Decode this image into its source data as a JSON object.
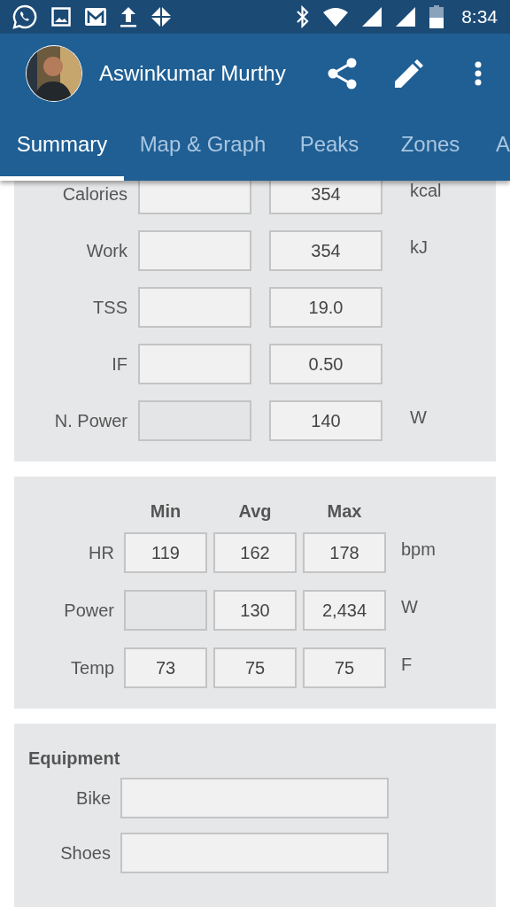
{
  "status_bar": {
    "time": "8:34"
  },
  "app_bar": {
    "title": "Aswinkumar Murthy"
  },
  "tabs": [
    {
      "label": "Summary",
      "selected": true
    },
    {
      "label": "Map & Graph",
      "selected": false
    },
    {
      "label": "Peaks",
      "selected": false
    },
    {
      "label": "Zones",
      "selected": false
    },
    {
      "label": "A",
      "selected": false
    }
  ],
  "totals": {
    "rows": [
      {
        "label": "Calories",
        "fields": [
          {
            "disabled": false
          },
          {
            "value": "354",
            "disabled": false
          }
        ],
        "unit": "kcal"
      },
      {
        "label": "Work",
        "fields": [
          {
            "disabled": false
          },
          {
            "value": "354",
            "disabled": false
          }
        ],
        "unit": "kJ"
      },
      {
        "label": "TSS",
        "fields": [
          {
            "disabled": false
          },
          {
            "value": "19.0",
            "disabled": false
          }
        ]
      },
      {
        "label": "IF",
        "fields": [
          {
            "disabled": false
          },
          {
            "value": "0.50",
            "disabled": false
          }
        ]
      },
      {
        "label": "N. Power",
        "fields": [
          {
            "disabled": true
          },
          {
            "value": "140",
            "disabled": false
          }
        ],
        "unit": "W"
      }
    ]
  },
  "stats": {
    "columns": [
      "Min",
      "Avg",
      "Max"
    ],
    "rows": [
      {
        "label": "HR",
        "fields": [
          {
            "value": "119",
            "disabled": false
          },
          {
            "value": "162",
            "disabled": false
          },
          {
            "value": "178",
            "disabled": false
          }
        ],
        "unit": "bpm"
      },
      {
        "label": "Power",
        "fields": [
          {
            "disabled": true
          },
          {
            "value": "130",
            "disabled": false
          },
          {
            "value": "2,434",
            "disabled": false
          }
        ],
        "unit": "W"
      },
      {
        "label": "Temp",
        "fields": [
          {
            "value": "73",
            "disabled": false
          },
          {
            "value": "75",
            "disabled": false
          },
          {
            "value": "75",
            "disabled": false
          }
        ],
        "unit": "F"
      }
    ]
  },
  "equipment": {
    "title": "Equipment",
    "fields": [
      {
        "label": "Bike"
      },
      {
        "label": "Shoes"
      }
    ]
  }
}
